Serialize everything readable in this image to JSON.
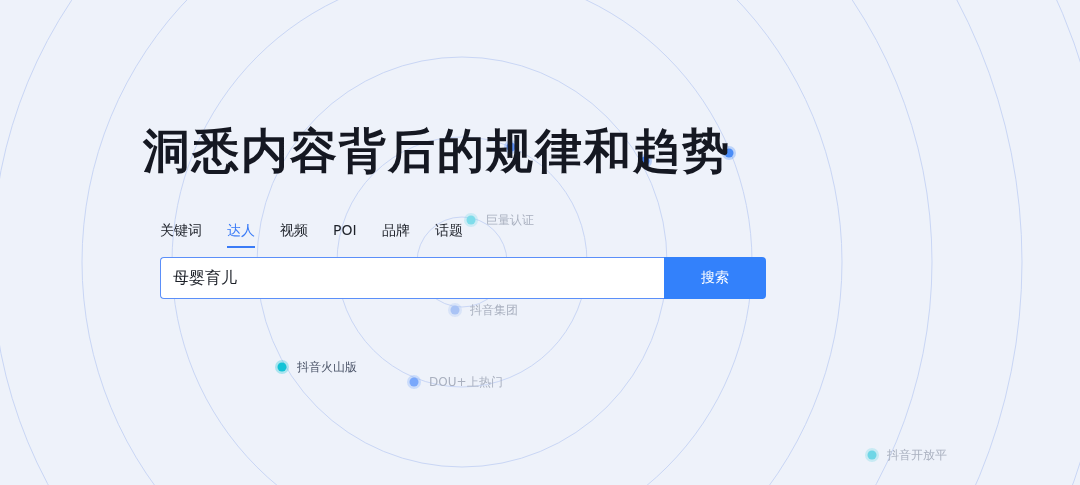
{
  "headline": "洞悉内容背后的规律和趋势",
  "tabs": [
    {
      "label": "关键词",
      "selected": false
    },
    {
      "label": "达人",
      "selected": true
    },
    {
      "label": "视频",
      "selected": false
    },
    {
      "label": "POI",
      "selected": false
    },
    {
      "label": "品牌",
      "selected": false
    },
    {
      "label": "话题",
      "selected": false
    }
  ],
  "search": {
    "value": "母婴育儿",
    "button": "搜索"
  },
  "nodes": [
    {
      "color": "#5b8ff9"
    },
    {
      "color": "#3f7ef5"
    },
    {
      "color": "#4a8cf7"
    },
    {
      "label": "巨量认证",
      "color": "#7fdcea"
    },
    {
      "label": "抖音集团",
      "color": "#a9c3f5"
    },
    {
      "label": "抖音火山版",
      "color": "#12c3d6"
    },
    {
      "label": "DOU+上热门",
      "color": "#7aa8fb"
    },
    {
      "label": "抖音开放平",
      "color": "#6fd6e6"
    }
  ]
}
